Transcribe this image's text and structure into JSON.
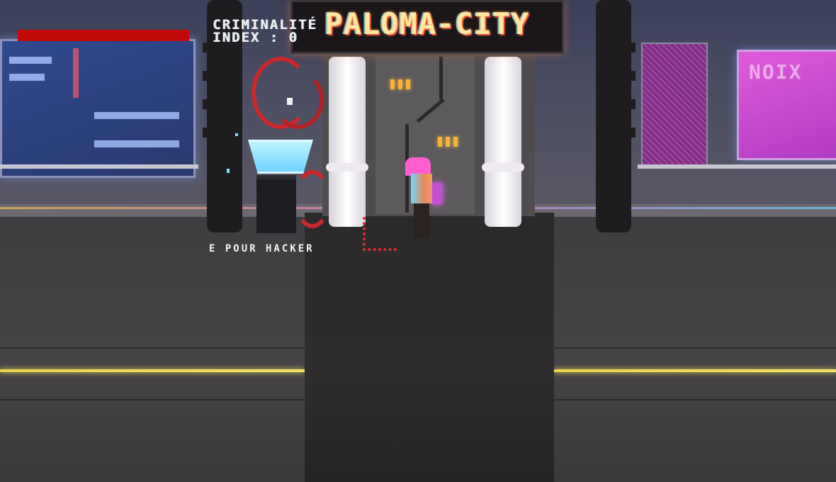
{
  "hud": {
    "health_fraction": 1.0,
    "criminality_label": "CRIMINALITÉ",
    "index_label": "INDEX : 0"
  },
  "world": {
    "city_sign": "PALOMA-CITY",
    "right_window_sign": "NOIX",
    "hack_prompt": "E POUR HACKER"
  },
  "colors": {
    "health": "#c4090a",
    "neon_yellow": "#f4e36a",
    "hair_pink": "#ff5fcf",
    "terminal_cyan": "#7ee2ff",
    "marker_red": "#e02b30"
  },
  "icons": {
    "objective_marker": "l-corner-marker-icon",
    "terminal": "hack-terminal-icon"
  }
}
